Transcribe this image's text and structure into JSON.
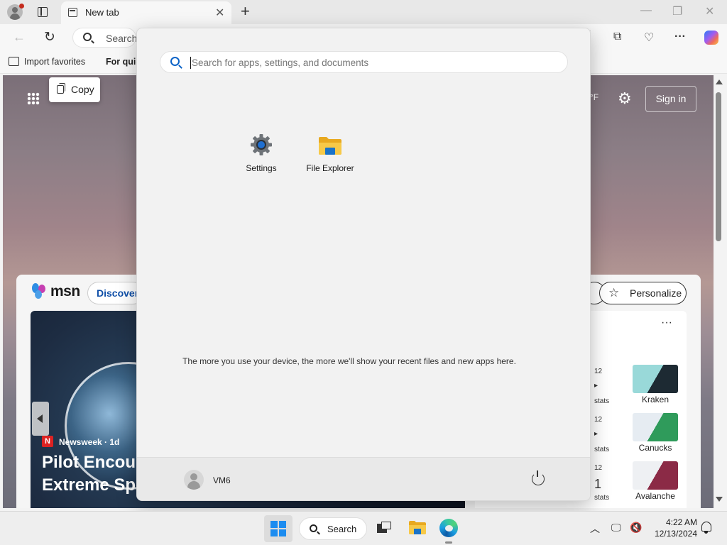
{
  "browser": {
    "tab_title": "New tab",
    "tab_close": "✕",
    "new_tab": "+",
    "minimize": "—",
    "restore": "❐",
    "close": "✕",
    "back": "←",
    "reload": "↻",
    "address_text": "Search",
    "toolbar_more": "···",
    "favorites": {
      "import_label": "Import favorites",
      "quick_label": "For quic"
    }
  },
  "page": {
    "copy_tooltip": "Copy",
    "weather_fragment": "°F",
    "sign_in": "Sign in",
    "feed": {
      "brand": "msn",
      "discover_label": "Discover",
      "personalize_label": "Personalize",
      "story": {
        "source": "Newsweek · 1d",
        "source_icon": "N",
        "headline_line1": "Pilot Encoun",
        "headline_line2": "Extreme Spe"
      },
      "sports": {
        "more": "···",
        "teams": [
          {
            "name": "Kraken",
            "score_top": "12",
            "score_mid": "▸",
            "score_bot": "stats",
            "color1": "#0d2f3f",
            "color2": "#99d9d9"
          },
          {
            "name": "Canucks",
            "score_top": "12",
            "score_mid": "▸",
            "score_bot": "stats",
            "color1": "#00205b",
            "color2": "#00843d"
          },
          {
            "name": "Avalanche",
            "score_top": "12",
            "score_mid": "1",
            "score_bot": "stats",
            "color1": "#6f263d",
            "color2": "#a2aaad"
          }
        ]
      }
    }
  },
  "start": {
    "search_placeholder": "Search for apps, settings, and documents",
    "apps": [
      {
        "label": "Settings",
        "icon": "settings-gear-icon"
      },
      {
        "label": "File Explorer",
        "icon": "folder-icon"
      }
    ],
    "hint": "The more you use your device, the more we'll show your recent files and new apps here.",
    "user_name": "VM6"
  },
  "taskbar": {
    "search_label": "Search",
    "tray_chevron": "︿",
    "time": "4:22 AM",
    "date": "12/13/2024"
  },
  "colors": {
    "accent": "#0b63c7",
    "windows_blue": "#1c8cf0",
    "folder_yellow": "#f4c430"
  }
}
